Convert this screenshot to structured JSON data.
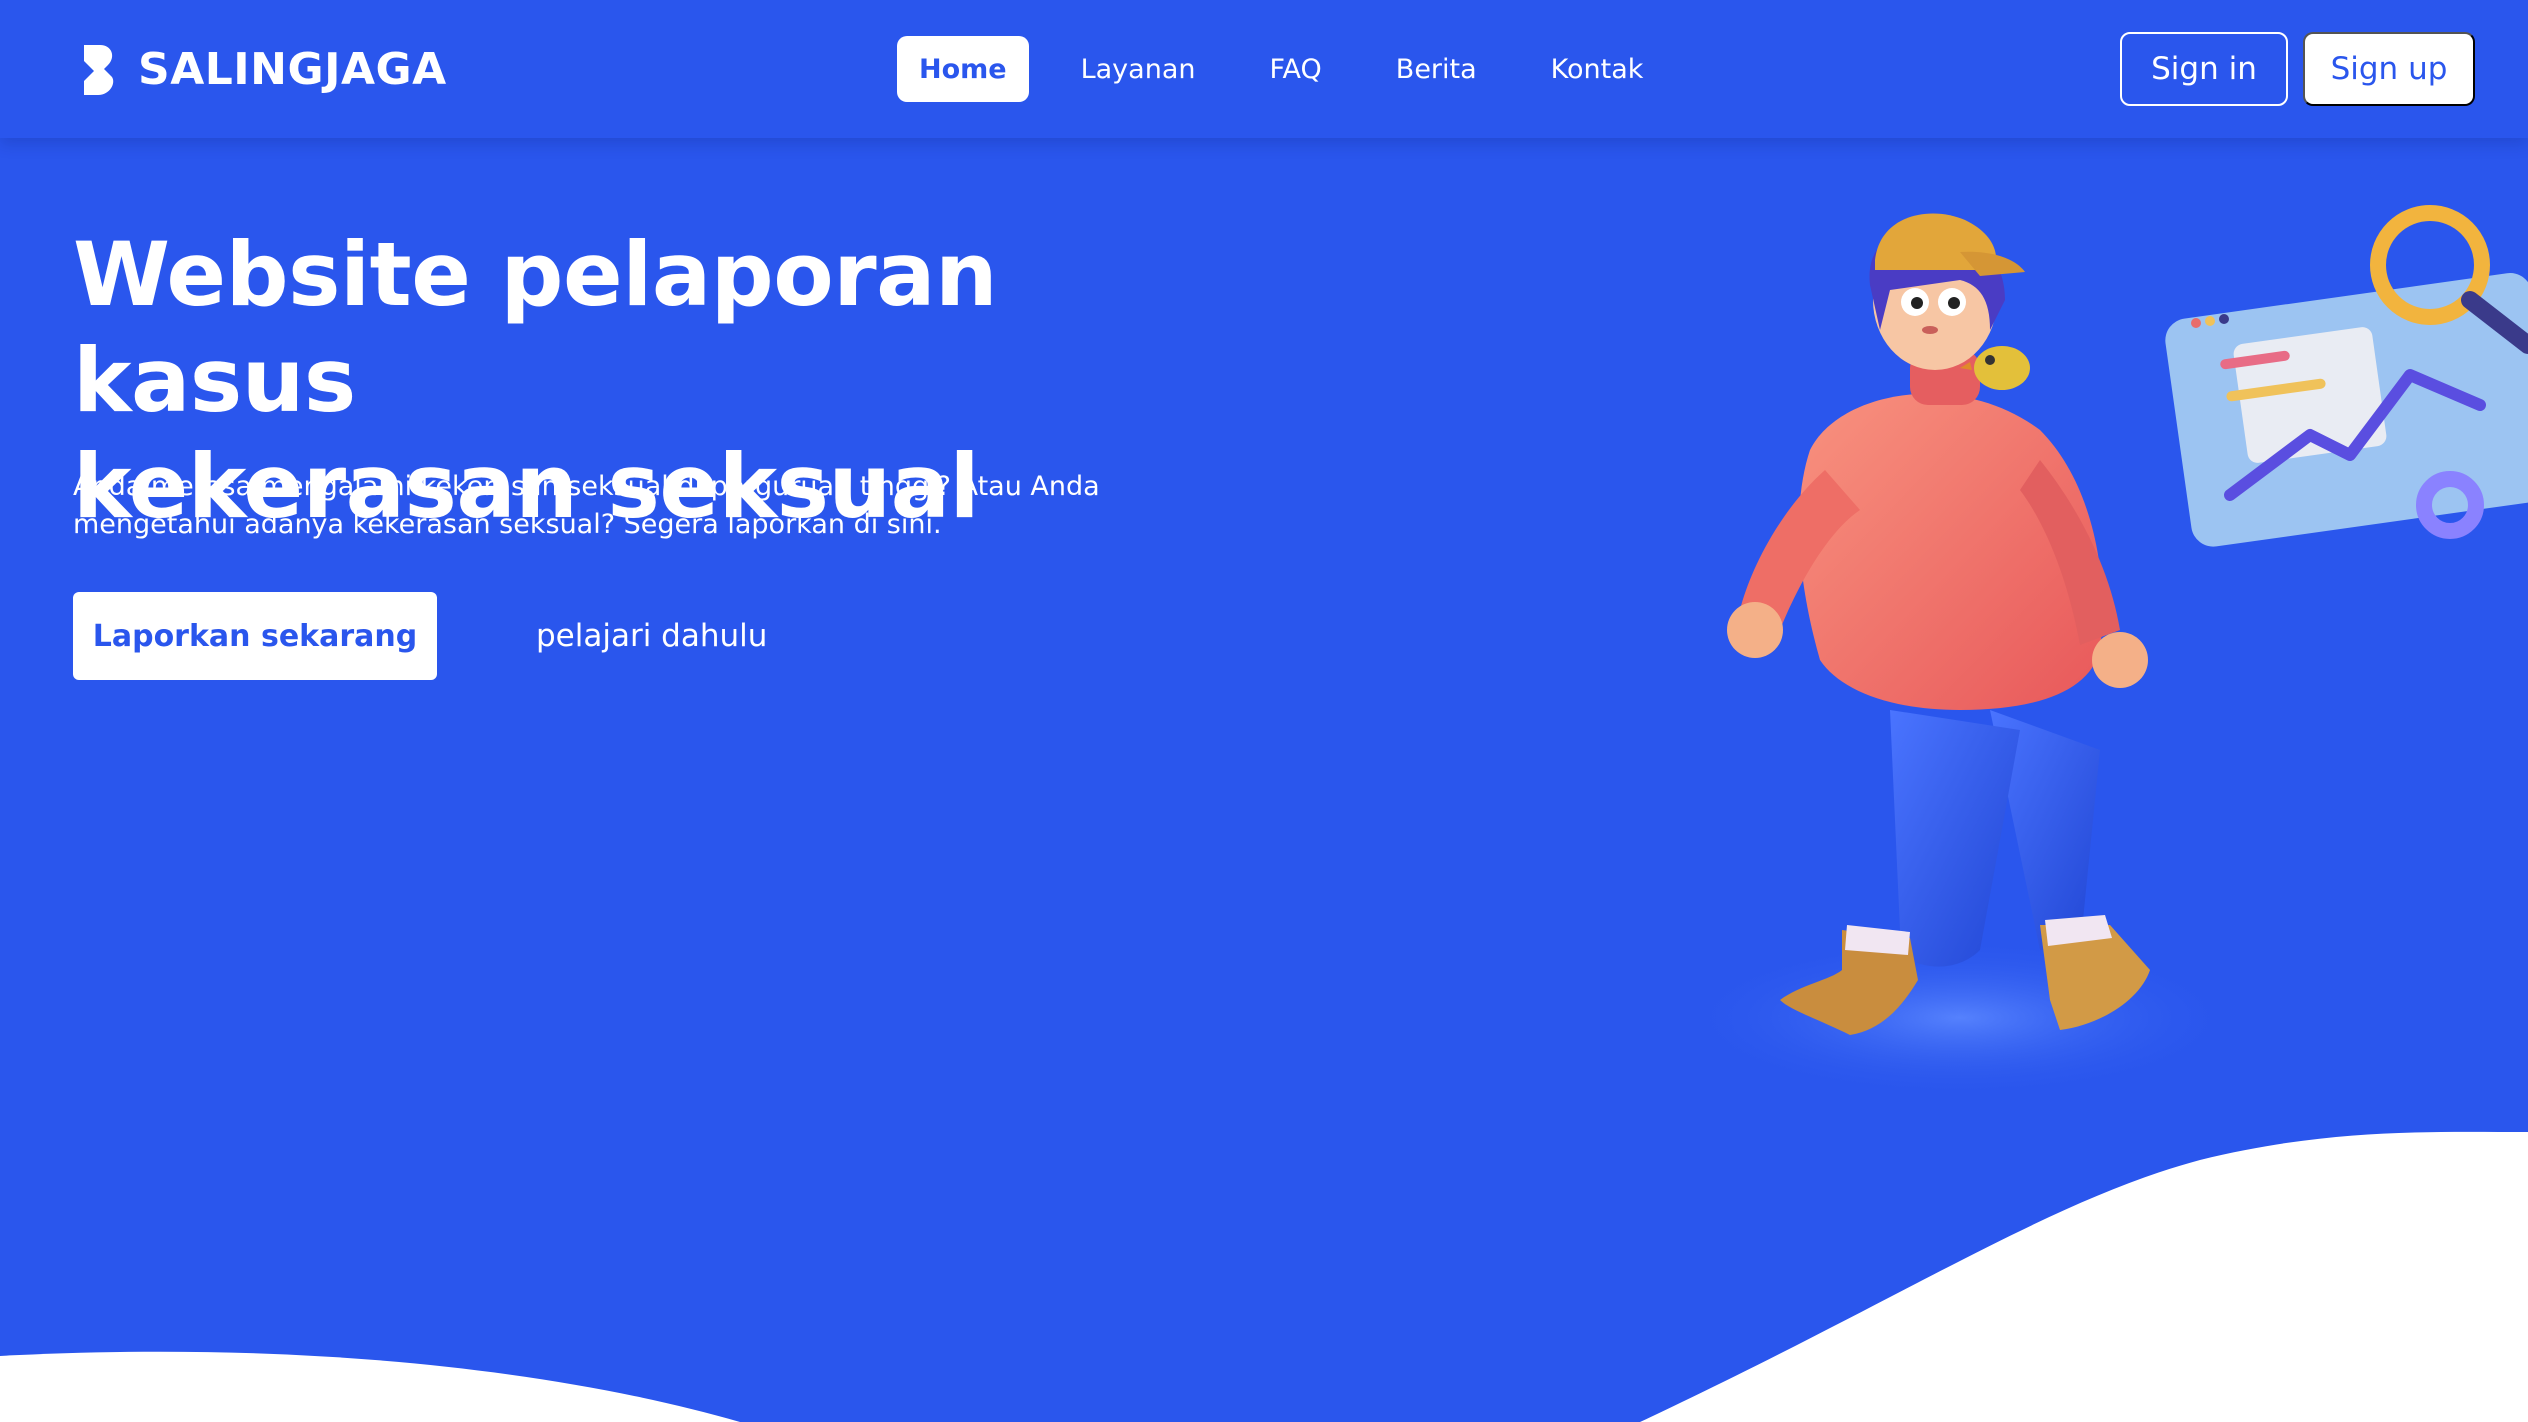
{
  "brand": {
    "name": "SALINGJAGA",
    "icon": "brand-logo-icon"
  },
  "nav": {
    "items": [
      {
        "label": "Home",
        "active": true
      },
      {
        "label": "Layanan",
        "active": false
      },
      {
        "label": "FAQ",
        "active": false
      },
      {
        "label": "Berita",
        "active": false
      },
      {
        "label": "Kontak",
        "active": false
      }
    ]
  },
  "auth": {
    "signin_label": "Sign in",
    "signup_label": "Sign up"
  },
  "hero": {
    "title_line1": "Website pelaporan kasus",
    "title_line2": "kekerasan seksual",
    "description": "Anda merasa mengalami kekerasan seksual di perguruan tinggi? Atau Anda mengetahui adanya kekerasan seksual? Segera laporkan di sini.",
    "primary_button": "Laporkan sekarang",
    "secondary_button": "pelajari dahulu"
  },
  "colors": {
    "primary": "#2a56ed",
    "white": "#ffffff"
  }
}
